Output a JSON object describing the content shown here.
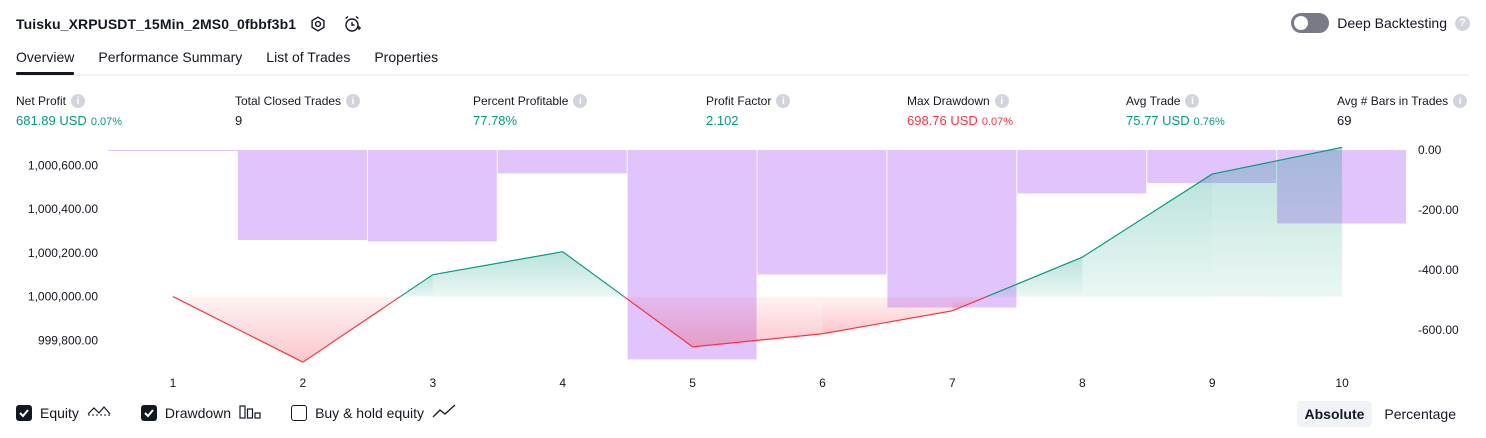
{
  "header": {
    "title": "Tuisku_XRPUSDT_15Min_2MS0_0fbbf3b1",
    "deep_backtesting_label": "Deep Backtesting",
    "deep_backtesting_enabled": false
  },
  "tabs": [
    {
      "label": "Overview",
      "active": true
    },
    {
      "label": "Performance Summary",
      "active": false
    },
    {
      "label": "List of Trades",
      "active": false
    },
    {
      "label": "Properties",
      "active": false
    }
  ],
  "metrics": [
    {
      "label": "Net Profit",
      "value": "681.89 USD",
      "sub": "0.07%",
      "color": "#089981"
    },
    {
      "label": "Total Closed Trades",
      "value": "9",
      "sub": "",
      "color": "#131722"
    },
    {
      "label": "Percent Profitable",
      "value": "77.78%",
      "sub": "",
      "color": "#089981"
    },
    {
      "label": "Profit Factor",
      "value": "2.102",
      "sub": "",
      "color": "#089981"
    },
    {
      "label": "Max Drawdown",
      "value": "698.76 USD",
      "sub": "0.07%",
      "color": "#f23645"
    },
    {
      "label": "Avg Trade",
      "value": "75.77 USD",
      "sub": "0.76%",
      "color": "#089981"
    },
    {
      "label": "Avg # Bars in Trades",
      "value": "69",
      "sub": "",
      "color": "#131722"
    }
  ],
  "chart_data": {
    "type": "line",
    "x": [
      1,
      2,
      3,
      4,
      5,
      6,
      7,
      8,
      9,
      10
    ],
    "left_axis_ticks": [
      "1,000,600.00",
      "1,000,400.00",
      "1,000,200.00",
      "1,000,000.00",
      "999,800.00"
    ],
    "right_axis_ticks": [
      "0.00",
      "-200.00",
      "-400.00",
      "-600.00"
    ],
    "left_ylim": [
      999710,
      1000670
    ],
    "right_ylim": [
      -700,
      0
    ],
    "baseline": 1000000,
    "series": [
      {
        "name": "Equity",
        "axis": "left",
        "values": [
          1000000,
          999700,
          1000100,
          1000205,
          999770,
          999830,
          999935,
          1000180,
          1000560,
          1000682
        ],
        "color_up": "#089981",
        "color_down": "#f23645"
      },
      {
        "name": "Drawdown",
        "axis": "right",
        "type": "bar",
        "values": [
          -1,
          -300,
          -305,
          -78,
          -698,
          -415,
          -525,
          -145,
          -110,
          -245
        ],
        "color": "#e1c4fc"
      }
    ]
  },
  "legend": [
    {
      "label": "Equity",
      "checked": true,
      "icon": "equity-line-icon"
    },
    {
      "label": "Drawdown",
      "checked": true,
      "icon": "drawdown-bars-icon"
    },
    {
      "label": "Buy & hold equity",
      "checked": false,
      "icon": "buy-hold-line-icon"
    }
  ],
  "view_mode": {
    "options": [
      "Absolute",
      "Percentage"
    ],
    "selected": "Absolute"
  }
}
